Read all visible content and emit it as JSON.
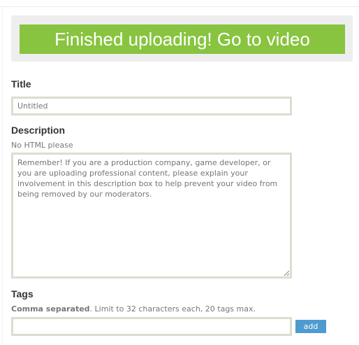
{
  "banner": {
    "label": "Finished uploading! Go to video"
  },
  "title": {
    "label": "Title",
    "placeholder": "Untitled"
  },
  "description": {
    "label": "Description",
    "hint": "No HTML please",
    "placeholder": "Remember! If you are a production company, game developer, or you are uploading professional content, please explain your involvement in this description box to help prevent your video from being removed by our moderators."
  },
  "tags": {
    "label": "Tags",
    "hint_bold": "Comma separated",
    "hint_rest": ". Limit to 32 characters each, 20 tags max.",
    "value": "",
    "add_label": "add"
  },
  "colors": {
    "banner_bg": "#88c43f",
    "add_button_bg": "#4e9bd0",
    "field_border": "#dddcd0"
  }
}
